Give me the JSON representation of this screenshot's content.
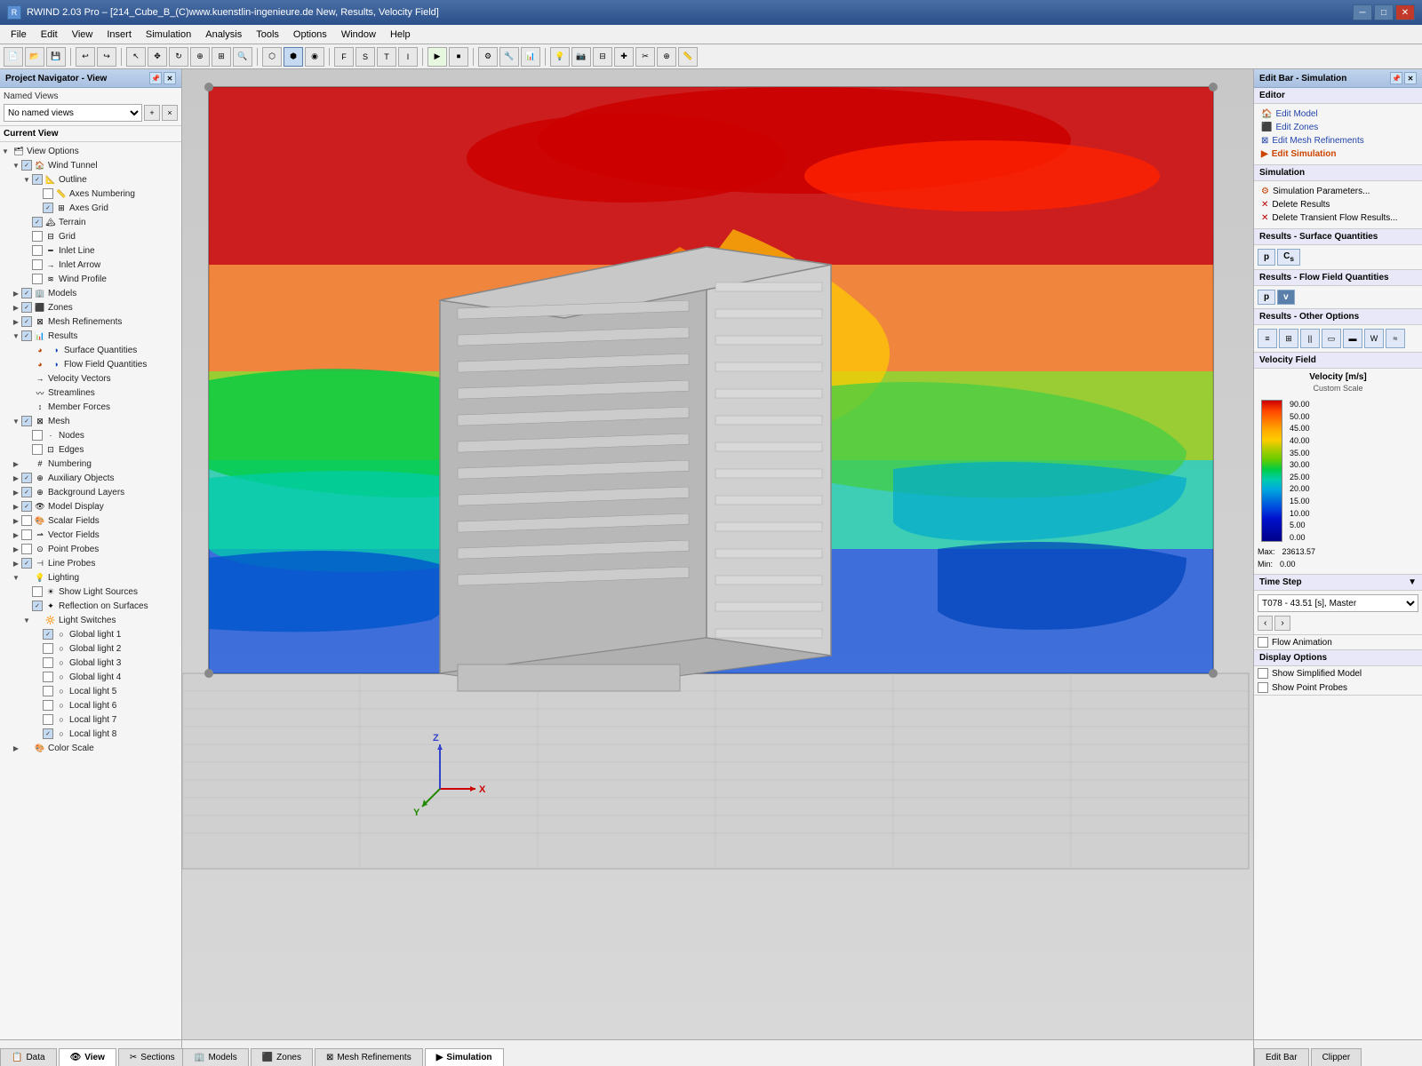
{
  "titlebar": {
    "title": "RWIND 2.03 Pro – [214_Cube_B_(C)www.kuenstlin-ingenieure.de New, Results, Velocity Field]",
    "icon": "R"
  },
  "menubar": {
    "items": [
      "File",
      "Edit",
      "View",
      "Insert",
      "Simulation",
      "Analysis",
      "Tools",
      "Options",
      "Window",
      "Help"
    ]
  },
  "left_panel": {
    "title": "Project Navigator - View",
    "named_views": {
      "label": "Named Views",
      "placeholder": "No named views"
    },
    "current_view": {
      "label": "Current View"
    },
    "tree": [
      {
        "id": "view-options",
        "label": "View Options",
        "level": 0,
        "expand": true,
        "checked": true,
        "has_check": false
      },
      {
        "id": "wind-tunnel",
        "label": "Wind Tunnel",
        "level": 1,
        "expand": true,
        "checked": true,
        "has_check": true
      },
      {
        "id": "outline",
        "label": "Outline",
        "level": 2,
        "expand": true,
        "checked": true,
        "has_check": true
      },
      {
        "id": "axes-numbering",
        "label": "Axes Numbering",
        "level": 3,
        "expand": false,
        "checked": false,
        "has_check": true
      },
      {
        "id": "axes-grid",
        "label": "Axes Grid",
        "level": 3,
        "expand": false,
        "checked": true,
        "has_check": true
      },
      {
        "id": "terrain",
        "label": "Terrain",
        "level": 2,
        "expand": false,
        "checked": true,
        "has_check": true
      },
      {
        "id": "grid",
        "label": "Grid",
        "level": 2,
        "expand": false,
        "checked": false,
        "has_check": true
      },
      {
        "id": "inlet-line",
        "label": "Inlet Line",
        "level": 2,
        "expand": false,
        "checked": false,
        "has_check": true
      },
      {
        "id": "inlet-arrow",
        "label": "Inlet Arrow",
        "level": 2,
        "expand": false,
        "checked": false,
        "has_check": true
      },
      {
        "id": "wind-profile",
        "label": "Wind Profile",
        "level": 2,
        "expand": false,
        "checked": false,
        "has_check": true
      },
      {
        "id": "models",
        "label": "Models",
        "level": 1,
        "expand": false,
        "checked": true,
        "has_check": true
      },
      {
        "id": "zones",
        "label": "Zones",
        "level": 1,
        "expand": false,
        "checked": true,
        "has_check": true
      },
      {
        "id": "mesh-refinements",
        "label": "Mesh Refinements",
        "level": 1,
        "expand": false,
        "checked": true,
        "has_check": true
      },
      {
        "id": "results",
        "label": "Results",
        "level": 1,
        "expand": true,
        "checked": true,
        "has_check": true
      },
      {
        "id": "surface-quantities",
        "label": "Surface Quantities",
        "level": 2,
        "expand": false,
        "checked": true,
        "has_check": false
      },
      {
        "id": "flow-field-quantities",
        "label": "Flow Field Quantities",
        "level": 2,
        "expand": false,
        "checked": true,
        "has_check": false
      },
      {
        "id": "velocity-vectors",
        "label": "Velocity Vectors",
        "level": 2,
        "expand": false,
        "checked": false,
        "has_check": false
      },
      {
        "id": "streamlines",
        "label": "Streamlines",
        "level": 2,
        "expand": false,
        "checked": false,
        "has_check": false
      },
      {
        "id": "member-forces",
        "label": "Member Forces",
        "level": 2,
        "expand": false,
        "checked": false,
        "has_check": false
      },
      {
        "id": "mesh",
        "label": "Mesh",
        "level": 1,
        "expand": true,
        "checked": true,
        "has_check": true
      },
      {
        "id": "nodes",
        "label": "Nodes",
        "level": 2,
        "expand": false,
        "checked": false,
        "has_check": true
      },
      {
        "id": "edges",
        "label": "Edges",
        "level": 2,
        "expand": false,
        "checked": false,
        "has_check": true
      },
      {
        "id": "numbering",
        "label": "Numbering",
        "level": 1,
        "expand": false,
        "checked": false,
        "has_check": false
      },
      {
        "id": "auxiliary-objects",
        "label": "Auxiliary Objects",
        "level": 1,
        "expand": false,
        "checked": true,
        "has_check": true
      },
      {
        "id": "background-layers",
        "label": "Background Layers",
        "level": 1,
        "expand": false,
        "checked": true,
        "has_check": true
      },
      {
        "id": "model-display",
        "label": "Model Display",
        "level": 1,
        "expand": false,
        "checked": true,
        "has_check": true
      },
      {
        "id": "scalar-fields",
        "label": "Scalar Fields",
        "level": 1,
        "expand": false,
        "checked": false,
        "has_check": true
      },
      {
        "id": "vector-fields",
        "label": "Vector Fields",
        "level": 1,
        "expand": false,
        "checked": false,
        "has_check": true
      },
      {
        "id": "point-probes",
        "label": "Point Probes",
        "level": 1,
        "expand": false,
        "checked": false,
        "has_check": true
      },
      {
        "id": "line-probes",
        "label": "Line Probes",
        "level": 1,
        "expand": false,
        "checked": true,
        "has_check": true
      },
      {
        "id": "lighting",
        "label": "Lighting",
        "level": 1,
        "expand": true,
        "checked": false,
        "has_check": false
      },
      {
        "id": "show-light-sources",
        "label": "Show Light Sources",
        "level": 2,
        "expand": false,
        "checked": false,
        "has_check": true
      },
      {
        "id": "reflection-on-surfaces",
        "label": "Reflection on Surfaces",
        "level": 2,
        "expand": false,
        "checked": true,
        "has_check": true
      },
      {
        "id": "light-switches",
        "label": "Light Switches",
        "level": 2,
        "expand": true,
        "checked": false,
        "has_check": false
      },
      {
        "id": "global-light-1",
        "label": "Global light 1",
        "level": 3,
        "expand": false,
        "checked": true,
        "has_check": true
      },
      {
        "id": "global-light-2",
        "label": "Global light 2",
        "level": 3,
        "expand": false,
        "checked": false,
        "has_check": true
      },
      {
        "id": "global-light-3",
        "label": "Global light 3",
        "level": 3,
        "expand": false,
        "checked": false,
        "has_check": true
      },
      {
        "id": "global-light-4",
        "label": "Global light 4",
        "level": 3,
        "expand": false,
        "checked": false,
        "has_check": true
      },
      {
        "id": "local-light-5",
        "label": "Local light 5",
        "level": 3,
        "expand": false,
        "checked": false,
        "has_check": true
      },
      {
        "id": "local-light-6",
        "label": "Local light 6",
        "level": 3,
        "expand": false,
        "checked": false,
        "has_check": true
      },
      {
        "id": "local-light-7",
        "label": "Local light 7",
        "level": 3,
        "expand": false,
        "checked": false,
        "has_check": true
      },
      {
        "id": "local-light-8",
        "label": "Local light 8",
        "level": 3,
        "expand": false,
        "checked": true,
        "has_check": true
      },
      {
        "id": "color-scale",
        "label": "Color Scale",
        "level": 1,
        "expand": false,
        "checked": false,
        "has_check": false
      }
    ]
  },
  "right_panel": {
    "title": "Edit Bar - Simulation",
    "editor": {
      "label": "Editor",
      "items": [
        "Edit Model",
        "Edit Zones",
        "Edit Mesh Refinements",
        "Edit Simulation"
      ]
    },
    "simulation": {
      "label": "Simulation",
      "items": [
        "Simulation Parameters...",
        "Delete Results",
        "Delete Transient Flow Results..."
      ]
    },
    "results_surface": {
      "label": "Results - Surface Quantities",
      "buttons": [
        {
          "id": "p",
          "label": "p",
          "active": false
        },
        {
          "id": "cs",
          "label": "Cs",
          "active": false
        }
      ]
    },
    "results_flow": {
      "label": "Results - Flow Field Quantities",
      "buttons": [
        {
          "id": "p2",
          "label": "p",
          "active": false
        },
        {
          "id": "v",
          "label": "v",
          "active": true
        }
      ]
    },
    "results_other": {
      "label": "Results - Other Options",
      "buttons": [
        "≡≡",
        "⊞",
        "||",
        "▭",
        "▬",
        "W",
        "≈"
      ]
    },
    "velocity_field": {
      "label": "Velocity Field",
      "title": "Velocity [m/s]",
      "subtitle": "Custom Scale",
      "scale": [
        {
          "value": "90.00",
          "color": "#cc0000"
        },
        {
          "value": "50.00",
          "color": "#ff4400"
        },
        {
          "value": "45.00",
          "color": "#ff6600"
        },
        {
          "value": "40.00",
          "color": "#ff9900"
        },
        {
          "value": "35.00",
          "color": "#ffcc00"
        },
        {
          "value": "30.00",
          "color": "#aacc00"
        },
        {
          "value": "25.00",
          "color": "#55cc00"
        },
        {
          "value": "20.00",
          "color": "#00cc44"
        },
        {
          "value": "15.00",
          "color": "#00ccaa"
        },
        {
          "value": "10.00",
          "color": "#00aadd"
        },
        {
          "value": "5.00",
          "color": "#0055dd"
        },
        {
          "value": "0.00",
          "color": "#0000aa"
        }
      ],
      "max_label": "Max:",
      "max_value": "23613.57",
      "min_label": "Min:",
      "min_value": "0.00"
    },
    "time_step": {
      "label": "Time Step",
      "value": "T078 - 43.51 [s], Master"
    },
    "display_options": {
      "label": "Display Options",
      "items": [
        {
          "id": "flow-animation",
          "label": "Flow Animation",
          "checked": false
        },
        {
          "id": "simplified-model",
          "label": "Show Simplified Model",
          "checked": false
        },
        {
          "id": "point-probes",
          "label": "Show Point Probes",
          "checked": false
        }
      ]
    }
  },
  "bottom_tabs_left": [
    {
      "id": "data",
      "label": "Data",
      "active": false
    },
    {
      "id": "view",
      "label": "View",
      "active": true
    },
    {
      "id": "sections",
      "label": "Sections",
      "active": false
    }
  ],
  "bottom_tabs_center": [
    {
      "id": "models",
      "label": "Models",
      "active": false
    },
    {
      "id": "zones",
      "label": "Zones",
      "active": false
    },
    {
      "id": "mesh-refinements",
      "label": "Mesh Refinements",
      "active": false
    },
    {
      "id": "simulation",
      "label": "Simulation",
      "active": true
    }
  ],
  "bottom_tabs_right": [
    {
      "id": "edit-bar",
      "label": "Edit Bar",
      "active": false
    },
    {
      "id": "clipper",
      "label": "Clipper",
      "active": false
    }
  ],
  "toolbar": {
    "groups": [
      [
        "📁",
        "💾",
        "🖨"
      ],
      [
        "↩",
        "↪"
      ],
      [
        "⊞",
        "✥",
        "🔍",
        "↻",
        "⟲",
        "⬜",
        "○"
      ],
      [
        "▶",
        "⏹",
        "⏭"
      ],
      [
        "⚙",
        "🔧",
        "📊"
      ]
    ]
  }
}
